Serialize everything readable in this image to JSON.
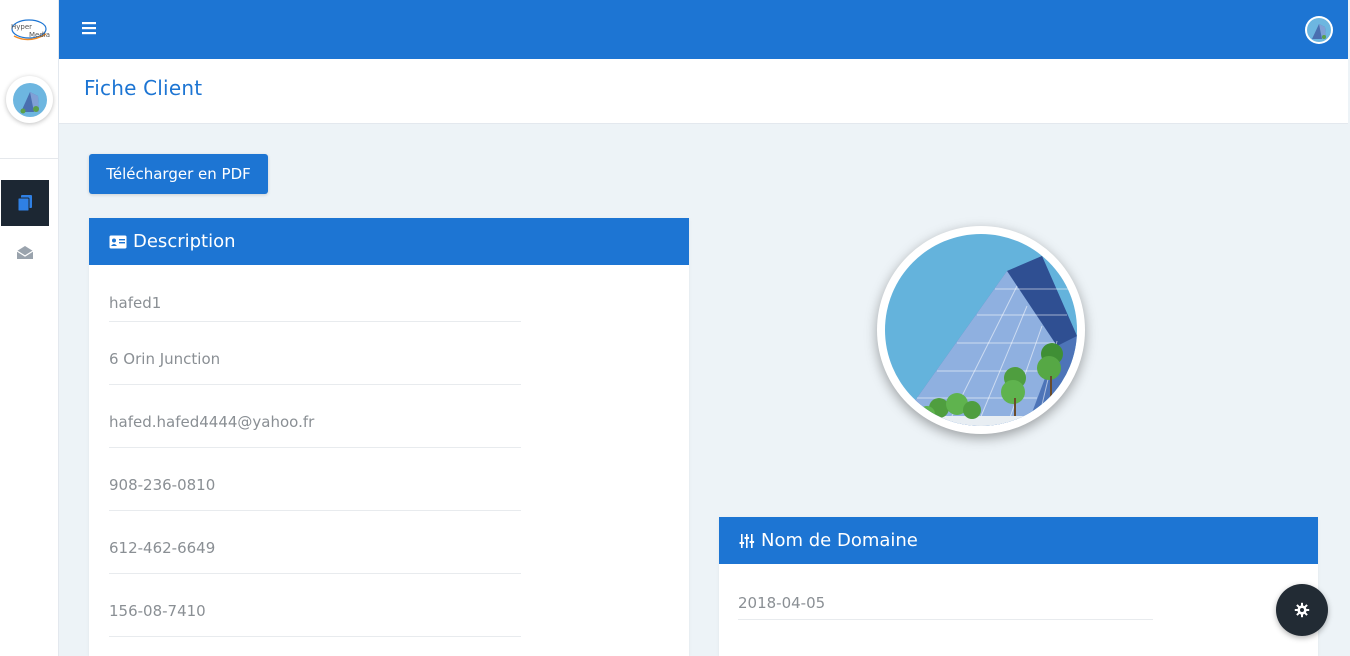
{
  "brand": {
    "logo_text_1": "Hyper",
    "logo_text_2": "Media"
  },
  "header": {
    "title": "Fiche Client"
  },
  "actions": {
    "pdf_label": "Télécharger en PDF"
  },
  "description": {
    "title": "Description",
    "fields": [
      "hafed1",
      "6 Orin Junction",
      "hafed.hafed4444@yahoo.fr",
      "908-236-0810",
      "612-462-6649",
      "156-08-7410"
    ]
  },
  "domain": {
    "title": "Nom de Domaine",
    "fields": [
      "2018-04-05"
    ]
  },
  "colors": {
    "primary": "#1d75d3",
    "sidebar_active": "#1c2733",
    "fab": "#222b34",
    "background": "#edf3f7"
  },
  "icons": {
    "menu": "bars-icon",
    "doc": "file-icon",
    "mail": "envelope-open-icon",
    "card": "id-card-icon",
    "sliders": "sliders-icon",
    "settings": "gear-icon"
  }
}
